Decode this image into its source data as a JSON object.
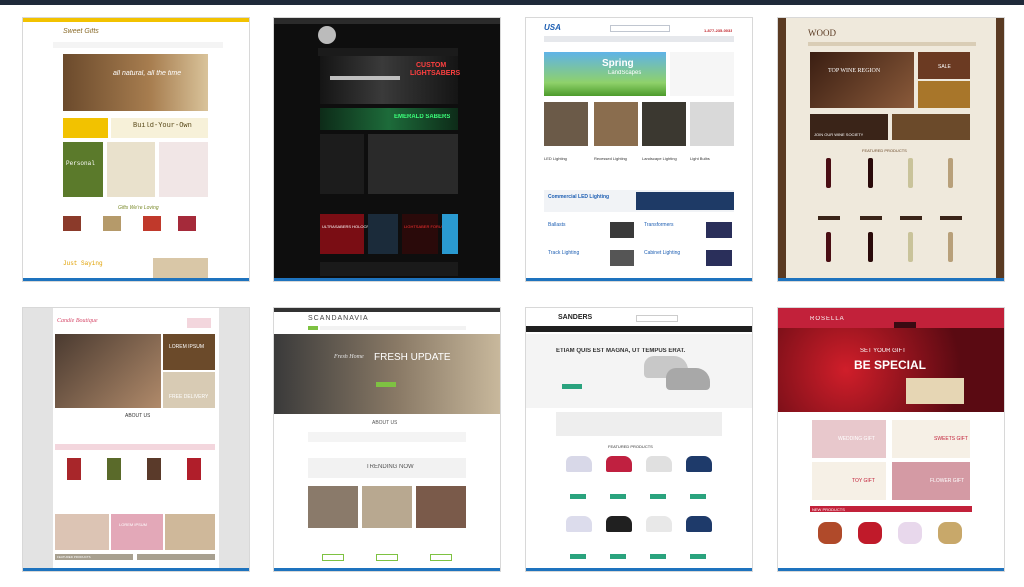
{
  "gallery": {
    "items": [
      {
        "id": "gifts",
        "brand": "Sweet Gifts",
        "hero_text": "all natural, all the time",
        "promo_1": "Build-Your-Own",
        "promo_2": "Personal",
        "section": "Gifts We're Loving",
        "footer_heading": "Just Saying",
        "colors": {
          "accent": "#f2c200",
          "bg": "#ffffff"
        }
      },
      {
        "id": "lightsabers",
        "hero_line1": "CUSTOM",
        "hero_line2": "LIGHTSABERS",
        "banner_2": "EMERALD SABERS",
        "banner_3": "ULTRASABERS HOLOCRON",
        "banner_4": "LIGHTSABER FORUM",
        "colors": {
          "accent": "#e02020",
          "bg": "#0e0e0e"
        }
      },
      {
        "id": "usa-lighting",
        "logo": "USA",
        "phone": "1-877-235-0033",
        "hero_title": "Spring",
        "hero_sub": "LandScapes",
        "categories": [
          "LED Lighting",
          "Recessed Lighting",
          "Landscape Lighting",
          "Light Bulbs"
        ],
        "rows": [
          "Commercial LED Lighting",
          "Ballasts",
          "Transformers",
          "Track Lighting",
          "Cabinet Lighting"
        ],
        "colors": {
          "accent": "#1e5fb3"
        }
      },
      {
        "id": "wood-wine",
        "logo": "WOOD",
        "hero_text": "TOP WINE REGION",
        "badge": "SALE",
        "join": "JOIN OUR WINE SOCIETY",
        "section": "FEATURED PRODUCTS",
        "colors": {
          "accent": "#6b3a22",
          "bg": "#5a3a22"
        }
      },
      {
        "id": "sweet-candles",
        "brand": "Candle Boutique",
        "hero_1": "LOREM IPSUM",
        "hero_2": "FREE DELIVERY",
        "section": "ABOUT US",
        "products": "FEATURED PRODUCTS",
        "promo": "LOREM IPSUM",
        "colors": {
          "accent": "#d64a6a",
          "bg": "#e9e9e9"
        }
      },
      {
        "id": "scandanavia",
        "brand": "SCANDANAVIA",
        "hero_small": "Fresh Home",
        "hero_big": "FRESH UPDATE",
        "section": "ABOUT US",
        "trending": "TRENDING NOW",
        "colors": {
          "accent": "#7ec242",
          "bg": "#3a3a3a"
        }
      },
      {
        "id": "sanders",
        "brand": "SANDERS",
        "hero_text": "ETIAM QUIS EST MAGNA, UT TEMPUS ERAT.",
        "section": "FEATURED PRODUCTS",
        "colors": {
          "accent": "#2aa37e",
          "bg": "#1f1f1f"
        }
      },
      {
        "id": "rosella",
        "brand": "ROSELLA",
        "hero_small": "SET YOUR GIFT",
        "hero_big": "BE SPECIAL",
        "tiles": [
          "WEDDING GIFT",
          "SWEETS GIFT",
          "TOY GIFT",
          "FLOWER GIFT"
        ],
        "section": "NEW PRODUCTS",
        "colors": {
          "accent": "#c2213a",
          "bg": "#8a1020"
        }
      }
    ]
  }
}
